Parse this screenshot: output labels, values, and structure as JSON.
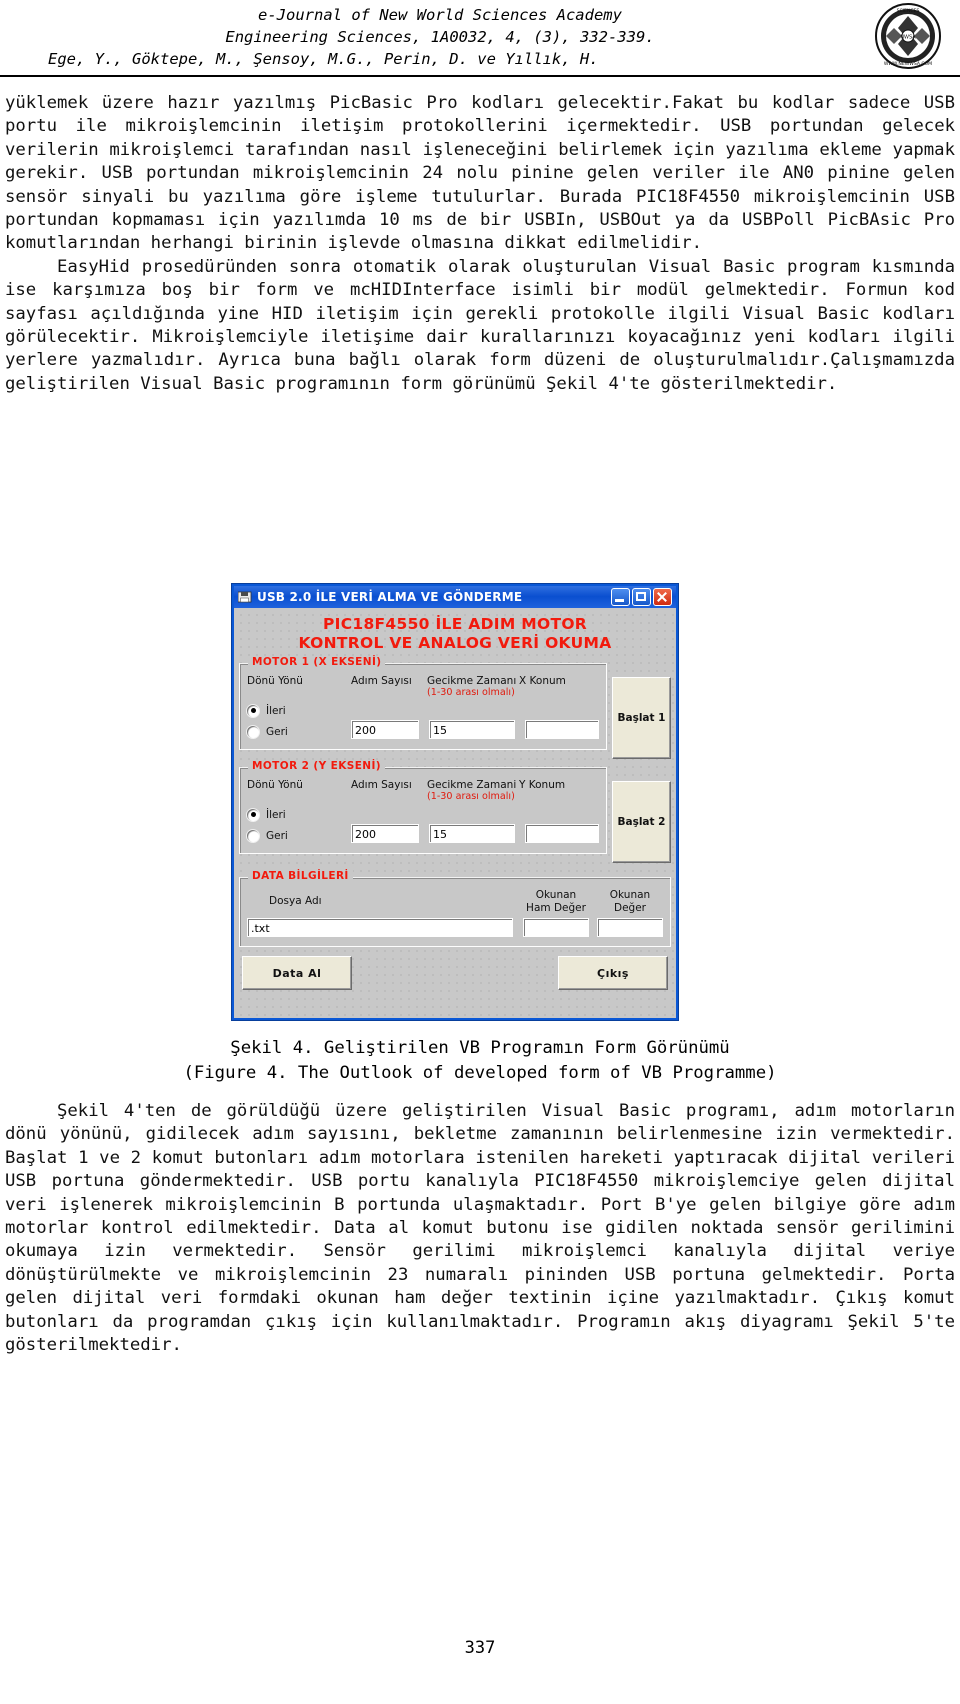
{
  "header": {
    "line1": "e-Journal of New World Sciences Academy",
    "line2": "Engineering Sciences, 1A0032, 4, (3), 332-339.",
    "line3": "Ege, Y., Göktepe, M., Şensoy, M.G., Perin, D. ve Yıllık, H.",
    "logo_alt": "academy-seal-logo"
  },
  "body": {
    "para1": "yüklemek üzere hazır yazılmış PicBasic Pro kodları gelecektir.Fakat bu kodlar sadece USB portu ile mikroişlemcinin iletişim protokollerini içermektedir. USB portundan gelecek verilerin mikroişlemci tarafından nasıl işleneceğini belirlemek için yazılıma ekleme yapmak gerekir. USB portundan mikroişlemcinin 24 nolu pinine gelen veriler ile AN0 pinine gelen sensör sinyali bu yazılıma göre işleme tutulurlar. Burada PIC18F4550 mikroişlemcinin USB portundan kopmaması için yazılımda 10 ms de bir USBIn, USBOut ya da USBPoll PicBAsic Pro komutlarından herhangi birinin işlevde olmasına dikkat edilmelidir.",
    "para2": "EasyHid prosedüründen sonra otomatik olarak oluşturulan Visual Basic program kısmında ise karşımıza boş bir form ve mcHIDInterface isimli bir modül gelmektedir. Formun kod sayfası açıldığında yine HID iletişim için gerekli protokolle ilgili Visual Basic kodları görülecektir. Mikroişlemciyle iletişime dair kurallarınızı koyacağınız yeni kodları ilgili yerlere yazmalıdır. Ayrıca buna bağlı olarak form düzeni de oluşturulmalıdır.Çalışmamızda geliştirilen Visual Basic programının form görünümü Şekil 4'te gösterilmektedir."
  },
  "vb_form": {
    "titlebar": {
      "icon": "floppy-disk-icon",
      "title": "USB 2.0 İLE VERİ ALMA VE GÖNDERME",
      "minimize_label": "minimize-icon",
      "maximize_label": "maximize-icon",
      "close_label": "close-icon"
    },
    "form_title_line1": "PIC18F4550 İLE ADIM MOTOR",
    "form_title_line2": "KONTROL VE ANALOG VERİ OKUMA",
    "motor1": {
      "group_title": "MOTOR 1 (X EKSENİ)",
      "col_direction": "Dönü Yönü",
      "col_steps": "Adım Sayısı",
      "col_delay": "Gecikme Zamanı",
      "col_position": "X Konum",
      "delay_note": "(1-30 arası olmalı)",
      "radio_forward": "İleri",
      "radio_backward": "Geri",
      "radio_selected": "İleri",
      "steps_value": "200",
      "delay_value": "15",
      "position_value": "",
      "start_button": "Başlat 1"
    },
    "motor2": {
      "group_title": "MOTOR 2 (Y EKSENİ)",
      "col_direction": "Dönü Yönü",
      "col_steps": "Adım Sayısı",
      "col_delay": "Gecikme Zamani",
      "col_position": "Y Konum",
      "delay_note": "(1-30 arası olmalı)",
      "radio_forward": "İleri",
      "radio_backward": "Geri",
      "radio_selected": "İleri",
      "steps_value": "200",
      "delay_value": "15",
      "position_value": "",
      "start_button": "Başlat 2"
    },
    "data": {
      "group_title": "DATA BİLGİLERİ",
      "filename_label": "Dosya Adı",
      "raw_label_l1": "Okunan",
      "raw_label_l2": "Ham Değer",
      "value_label_l1": "Okunan",
      "value_label_l2": "Değer",
      "filename_value": ".txt",
      "raw_value": "",
      "value_value": ""
    },
    "buttons": {
      "get_data": "Data Al",
      "exit": "Çıkış"
    }
  },
  "caption": {
    "line1": "Şekil 4. Geliştirilen VB Programın Form Görünümü",
    "line2": "(Figure 4. The Outlook of developed form of VB Programme)"
  },
  "body2": {
    "para1": "Şekil 4'ten de görüldüğü üzere geliştirilen Visual Basic programı, adım motorların dönü yönünü, gidilecek adım sayısını, bekletme zamanının belirlenmesine izin vermektedir. Başlat 1 ve 2 komut butonları adım motorlara istenilen hareketi yaptıracak dijital verileri USB portuna göndermektedir. USB portu kanalıyla PIC18F4550 mikroişlemciye gelen dijital veri işlenerek mikroişlemcinin B portunda ulaşmaktadır. Port B'ye gelen bilgiye göre adım motorlar kontrol edilmektedir. Data al komut butonu ise gidilen noktada sensör gerilimini okumaya izin vermektedir. Sensör gerilimi mikroişlemci kanalıyla dijital veriye dönüştürülmekte ve mikroişlemcinin 23 numaralı pininden USB portuna gelmektedir. Porta gelen dijital veri formdaki okunan ham değer textinin içine yazılmaktadır. Çıkış komut butonları da programdan çıkış için kullanılmaktadır. Programın akış diyagramı Şekil 5'te gösterilmektedir."
  },
  "page_number": "337",
  "colors": {
    "form_red": "#f21a0d",
    "titlebar_blue": "#0a4fd0",
    "form_face": "#c8c8c8",
    "button_face": "#ece9d8"
  }
}
